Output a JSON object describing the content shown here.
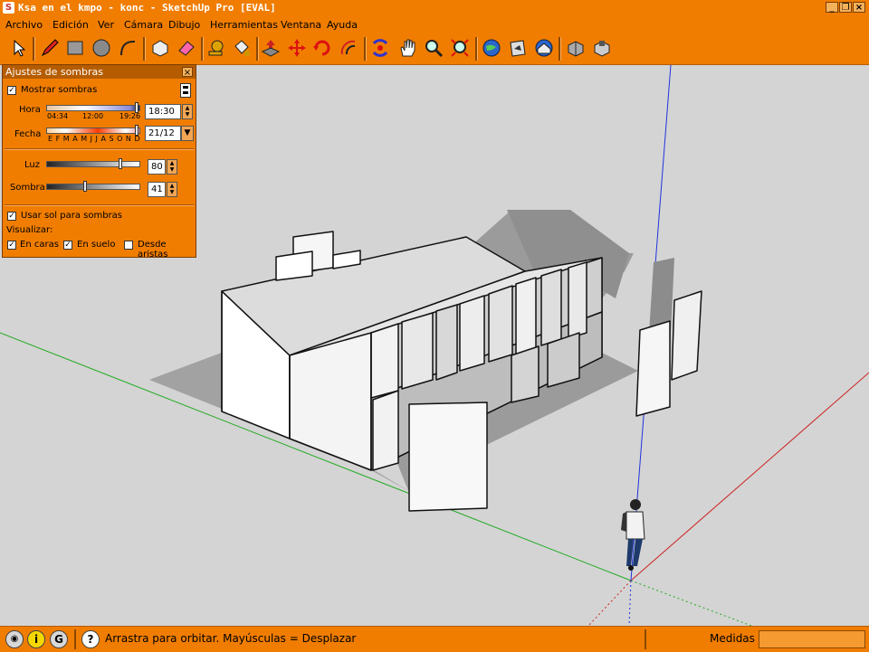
{
  "window": {
    "title": "Ksa en el kmpo - konc - SketchUp Pro [EVAL]",
    "minimize": "_",
    "restore": "❐",
    "close": "×"
  },
  "menu": [
    "Archivo",
    "Edición",
    "Ver",
    "Cámara",
    "Dibujo",
    "Herramientas",
    "Ventana",
    "Ayuda"
  ],
  "toolbar": {
    "tools": [
      "select-icon",
      "pencil-icon",
      "rectangle-icon",
      "circle-icon",
      "arc-icon",
      "make-component-icon",
      "eraser-icon",
      "tape-measure-icon",
      "paint-bucket-icon",
      "push-pull-icon",
      "move-icon",
      "rotate-icon",
      "offset-icon",
      "orbit-icon",
      "pan-icon",
      "zoom-icon",
      "zoom-extents-icon",
      "google-earth-icon",
      "place-model-icon",
      "get-models-icon",
      "share-component-icon",
      "warehouse-component-icon"
    ]
  },
  "shadow_panel": {
    "title": "Ajustes de sombras",
    "close": "×",
    "show_shadows_label": "Mostrar sombras",
    "show_shadows": true,
    "time_label": "Hora",
    "time_ticks": [
      "04:34",
      "12:00",
      "19:26"
    ],
    "time_value": "18:30",
    "date_label": "Fecha",
    "month_ticks": "E F M A M J J A S O N D",
    "date_value": "21/12",
    "light_label": "Luz",
    "light_value": "80",
    "light_level": 0.8,
    "dark_label": "Sombra",
    "dark_value": "41",
    "dark_level": 0.41,
    "use_sun_label": "Usar sol para sombras",
    "use_sun": true,
    "display_label": "Visualizar:",
    "on_faces_label": "En caras",
    "on_faces": true,
    "on_ground_label": "En suelo",
    "on_ground": true,
    "from_edges_label": "Desde aristas",
    "from_edges": false
  },
  "status": {
    "icons": [
      "geo-location-icon",
      "credits-icon",
      "user-icon",
      "help-icon"
    ],
    "message": "Arrastra para orbitar. Mayúsculas = Desplazar",
    "measurements_label": "Medidas",
    "measurements_value": ""
  },
  "colors": {
    "chrome_orange": "#f07d00",
    "axis_blue": "#2233dd",
    "axis_green": "#22aa22",
    "axis_red": "#cc2222"
  }
}
